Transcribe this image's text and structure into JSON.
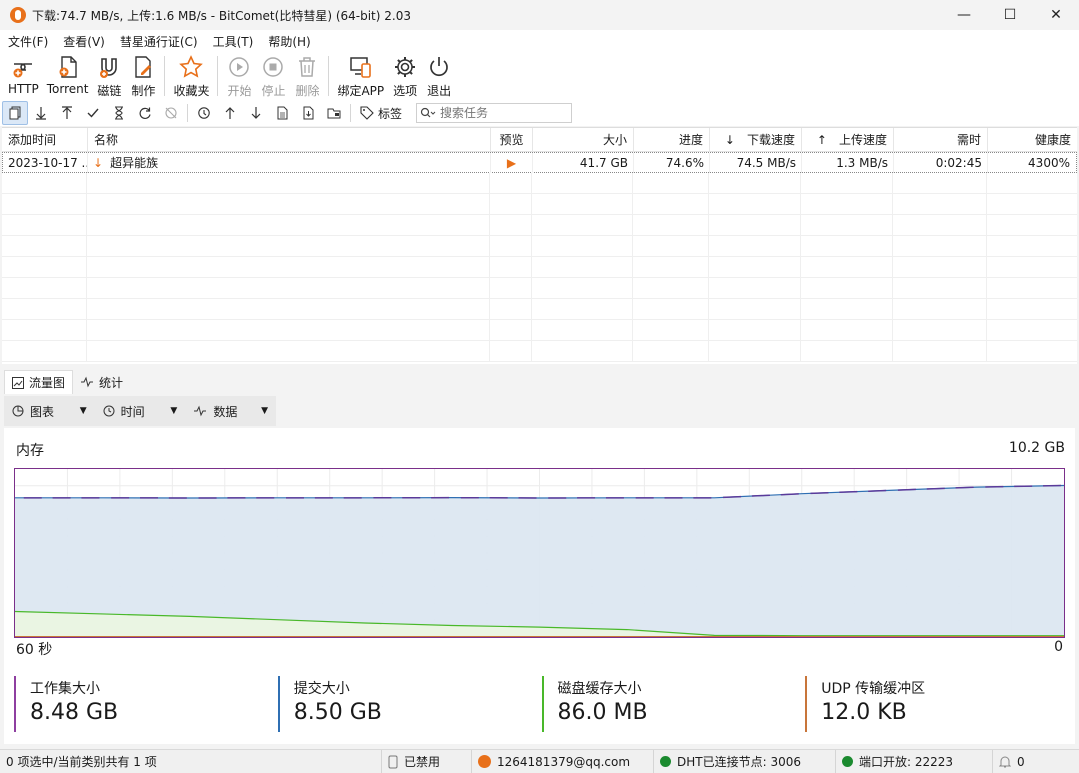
{
  "window": {
    "title": "下载:74.7 MB/s, 上传:1.6 MB/s - BitComet(比特彗星) (64-bit) 2.03",
    "minimize": "—",
    "maximize": "☐",
    "close": "✕"
  },
  "menu": [
    "文件(F)",
    "查看(V)",
    "彗星通行证(C)",
    "工具(T)",
    "帮助(H)"
  ],
  "toolbar": {
    "http": "HTTP",
    "torrent": "Torrent",
    "magnet": "磁链",
    "make": "制作",
    "favorites": "收藏夹",
    "start": "开始",
    "stop": "停止",
    "delete": "删除",
    "bind_app": "绑定APP",
    "options": "选项",
    "exit": "退出"
  },
  "toolbar2": {
    "tag_label": "标签",
    "search_placeholder": "搜索任务"
  },
  "table": {
    "headers": [
      "添加时间",
      "名称",
      "预览",
      "大小",
      "进度",
      "下载速度",
      "上传速度",
      "需时",
      "健康度"
    ],
    "rows": [
      {
        "added": "2023-10-17 ...",
        "name": "超异能族",
        "preview": "▶",
        "size": "41.7 GB",
        "progress": "74.6%",
        "download": "74.5 MB/s",
        "upload": "1.3 MB/s",
        "eta": "0:02:45",
        "health": "4300%"
      }
    ]
  },
  "tabs": [
    "流量图",
    "统计"
  ],
  "subbar": [
    "图表",
    "时间",
    "数据"
  ],
  "chart_data": {
    "type": "area",
    "title": "内存",
    "y_max_label": "10.2 GB",
    "x_left_label": "60 秒",
    "x_right_label": "0",
    "ylim": [
      0,
      10.2
    ],
    "x": [
      60,
      55,
      50,
      45,
      40,
      35,
      30,
      25,
      20,
      15,
      10,
      5,
      0
    ],
    "series": [
      {
        "color": "#2f6fb3",
        "values": [
          8.45,
          8.45,
          8.44,
          8.45,
          8.45,
          8.46,
          8.44,
          8.45,
          8.45,
          8.7,
          8.9,
          9.1,
          9.2
        ]
      },
      {
        "color": "#49b82a",
        "values": [
          1.55,
          1.4,
          1.25,
          1.05,
          0.85,
          0.7,
          0.6,
          0.45,
          0.1,
          0.08,
          0.08,
          0.08,
          0.08
        ]
      }
    ],
    "grid": true
  },
  "stats": [
    {
      "label": "工作集大小",
      "value": "8.48 GB",
      "color": "#8e3fa0"
    },
    {
      "label": "提交大小",
      "value": "8.50 GB",
      "color": "#2f6fb3"
    },
    {
      "label": "磁盘缓存大小",
      "value": "86.0 MB",
      "color": "#49b82a"
    },
    {
      "label": "UDP 传输缓冲区",
      "value": "12.0 KB",
      "color": "#c8753a"
    }
  ],
  "status": {
    "selection": "0 项选中/当前类别共有 1 项",
    "disabled": "已禁用",
    "account": "1264181379@qq.com",
    "dht": "DHT已连接节点:  3006",
    "port": "端口开放:  22223",
    "bell_count": "0"
  },
  "colors": {
    "accent_orange": "#e8701a",
    "status_green": "#1b8a2f"
  }
}
